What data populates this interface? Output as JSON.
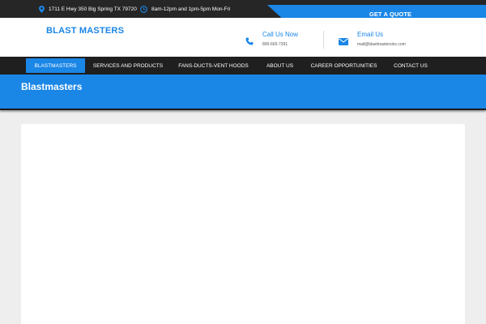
{
  "topbar": {
    "address": "1711 E Hwy 350 Big Spring TX 79720",
    "hours": "8am-12pm and 1pm-5pm Mon-Fri",
    "quote_label": "GET A QUOTE"
  },
  "header": {
    "logo": "BLAST MASTERS",
    "call_title": "Call Us Now",
    "call_number": "800-665-7391",
    "email_title": "Email Us",
    "email_address": "mail@blastmastersinc.com"
  },
  "nav": {
    "items": [
      {
        "label": "BLASTMASTERS"
      },
      {
        "label": "SERVICES AND PRODUCTS"
      },
      {
        "label": "FANS-DUCTS-VENT HOODS"
      },
      {
        "label": "ABOUT US"
      },
      {
        "label": "CAREER OPPORTUNITIES"
      },
      {
        "label": "CONTACT US"
      }
    ]
  },
  "banner": {
    "title": "Blastmasters"
  },
  "colors": {
    "accent": "#1a86e6",
    "dark": "#262626",
    "page_bg": "#eeeeee"
  },
  "icons": {
    "address": "map-pin-icon",
    "hours": "clock-icon",
    "call": "phone-icon",
    "email": "envelope-icon"
  }
}
